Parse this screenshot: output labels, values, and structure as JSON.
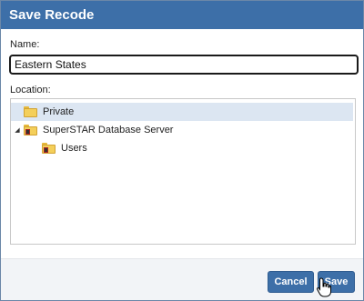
{
  "dialog": {
    "title": "Save Recode",
    "name_label": "Name:",
    "name_value": "Eastern States",
    "location_label": "Location:",
    "tree": {
      "private_label": "Private",
      "server_label": "SuperSTAR Database Server",
      "server_toggle": "◢",
      "users_label": "Users"
    },
    "buttons": {
      "cancel_label": "Cancel",
      "save_label": "Save"
    }
  },
  "colors": {
    "accent": "#3d6fa8",
    "selection": "#dce6f2"
  },
  "icons": [
    "folder-icon",
    "server-folder-icon",
    "expand-toggle-icon",
    "hand-cursor-icon"
  ]
}
